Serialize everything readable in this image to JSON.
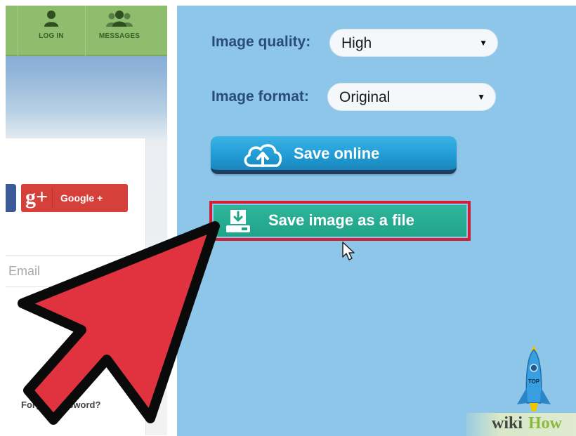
{
  "left_panel": {
    "nav": {
      "login_label": "LOG IN",
      "messages_label": "MESSAGES"
    },
    "google_button_label": "Google +",
    "google_logo": "g+",
    "email_placeholder": "Email",
    "forgot_password_text": "Forgot password?"
  },
  "right_panel": {
    "image_quality": {
      "label": "Image quality:",
      "selected": "High"
    },
    "image_format": {
      "label": "Image format:",
      "selected": "Original"
    },
    "save_online_label": "Save online",
    "save_file_label": "Save image as a file",
    "rocket_label": "TOP"
  },
  "watermark": {
    "wiki": "wiki",
    "how": "How"
  },
  "colors": {
    "panel_bg": "#8ec6ea",
    "label_text": "#2a4d78",
    "save_online_button": "#1f9ad3",
    "save_file_button": "#20a489",
    "highlight_border": "#d11f37",
    "arrow": "#e0333f",
    "nav_bar": "#8ebd6e"
  },
  "icons": {
    "cloud_upload": "cloud-upload-icon",
    "download_drive": "download-drive-icon",
    "user": "user-icon",
    "users": "users-icon",
    "cursor": "mouse-pointer-icon",
    "rocket": "rocket-icon"
  }
}
